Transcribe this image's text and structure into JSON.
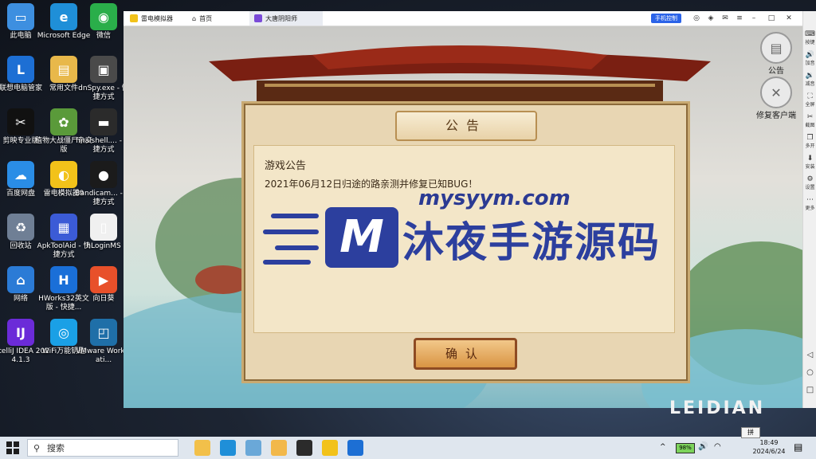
{
  "desktop_icons": [
    {
      "label": "此电脑",
      "color": "#3d8fe0",
      "glyph": "▭"
    },
    {
      "label": "Microsoft Edge",
      "color": "#1f8fd8",
      "glyph": "e"
    },
    {
      "label": "微信",
      "color": "#2aae4a",
      "glyph": "◉"
    },
    {
      "label": "联想电脑管家",
      "color": "#1d6fd4",
      "glyph": "L"
    },
    {
      "label": "常用文件",
      "color": "#e8b84a",
      "glyph": "▤"
    },
    {
      "label": "dnSpy.exe - 快捷方式",
      "color": "#4a4a4a",
      "glyph": "▣"
    },
    {
      "label": "剪映专业版",
      "color": "#111111",
      "glyph": "✂"
    },
    {
      "label": "植物大战僵尸杂交版",
      "color": "#5a9a3a",
      "glyph": "✿"
    },
    {
      "label": "finalshell.... - 快捷方式",
      "color": "#2b2b2b",
      "glyph": "▬"
    },
    {
      "label": "百度网盘",
      "color": "#2a8de6",
      "glyph": "☁"
    },
    {
      "label": "雷电模拟器9",
      "color": "#f2c21a",
      "glyph": "◐"
    },
    {
      "label": "Bandicam... - 快捷方式",
      "color": "#1b1b1b",
      "glyph": "●"
    },
    {
      "label": "回收站",
      "color": "#6f7f95",
      "glyph": "♻"
    },
    {
      "label": "ApkToolAid - 快捷方式",
      "color": "#3b5bd6",
      "glyph": "▦"
    },
    {
      "label": "hLoginMS",
      "color": "#f0f0f0",
      "glyph": "▯"
    },
    {
      "label": "网络",
      "color": "#2b7bd6",
      "glyph": "⌂"
    },
    {
      "label": "HWorks32英文版 - 快捷...",
      "color": "#1a6fd8",
      "glyph": "H"
    },
    {
      "label": "向日葵",
      "color": "#e8502a",
      "glyph": "▶"
    },
    {
      "label": "IntelliJ IDEA 2024.1.3",
      "color": "#6b2bd8",
      "glyph": "IJ"
    },
    {
      "label": "WiFi万能钥匙",
      "color": "#1aa0e6",
      "glyph": "◎"
    },
    {
      "label": "VMware Workstati...",
      "color": "#1f6fa8",
      "glyph": "◰"
    }
  ],
  "emulator": {
    "tabs": [
      {
        "label": "雷电模拟器",
        "icon": "leidian-logo-icon",
        "color": "#f2c21a"
      },
      {
        "label": "首页",
        "icon": "home-icon",
        "color": "#666666"
      },
      {
        "label": "大唐阴阳师",
        "icon": "game-icon",
        "color": "#7a4ad8"
      }
    ],
    "mobile_control_label": "手机控制",
    "sidebar": [
      {
        "label": "按键",
        "icon": "keyboard-icon",
        "glyph": "⌨"
      },
      {
        "label": "加音",
        "icon": "volume-up-icon",
        "glyph": "🔊"
      },
      {
        "label": "减音",
        "icon": "volume-down-icon",
        "glyph": "🔉"
      },
      {
        "label": "全屏",
        "icon": "fullscreen-icon",
        "glyph": "⛶"
      },
      {
        "label": "截图",
        "icon": "scissors-icon",
        "glyph": "✂"
      },
      {
        "label": "多开",
        "icon": "multi-instance-icon",
        "glyph": "❐"
      },
      {
        "label": "安装",
        "icon": "install-icon",
        "glyph": "⬇"
      },
      {
        "label": "设置",
        "icon": "gear-icon",
        "glyph": "⚙"
      },
      {
        "label": "更多",
        "icon": "more-icon",
        "glyph": "⋯"
      }
    ],
    "game_buttons": [
      {
        "label": "公告",
        "glyph": "▤"
      },
      {
        "label": "修复客户端",
        "glyph": "✕"
      }
    ],
    "brand_text": "LEIDIAN"
  },
  "notice": {
    "title": "公告",
    "heading": "游戏公告",
    "line": "2021年06月12日归途的路亲测并修复已知BUG！",
    "confirm_label": "确认"
  },
  "watermark": {
    "url": "mysyym.com",
    "logo_letter": "M",
    "chinese": "沐夜手游源码"
  },
  "taskbar": {
    "search_placeholder": "搜索",
    "apps": [
      {
        "name": "file-explorer-icon",
        "color": "#f2c04a"
      },
      {
        "name": "edge-icon",
        "color": "#1f8fd8"
      },
      {
        "name": "vmware-icon",
        "color": "#6aa8d8"
      },
      {
        "name": "note-icon",
        "color": "#f2b84a"
      },
      {
        "name": "finalshell-icon",
        "color": "#2b2b2b"
      },
      {
        "name": "leidian-icon",
        "color": "#f2c21a"
      },
      {
        "name": "lenovo-icon",
        "color": "#1d6fd4"
      }
    ],
    "battery": "98%",
    "ime": "拼",
    "time": "18:49",
    "date": "2024/6/24"
  }
}
